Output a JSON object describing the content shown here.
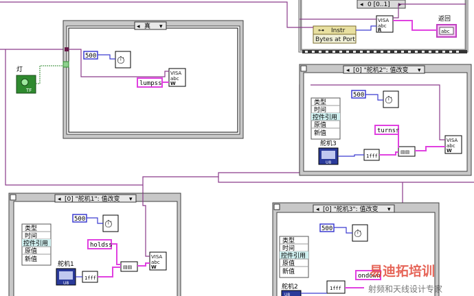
{
  "top_case": {
    "selector": "0 [0..1]",
    "property_node_label": "Instr",
    "property_item": "Bytes at Port",
    "visa_read_label": "VISA abc R",
    "indicator_label": "返回",
    "indicator_type": "abc"
  },
  "main_case": {
    "selector": "真",
    "led_label": "灯",
    "led_terminal": "TF",
    "wait_constant": "500",
    "string_constant": "lumpss",
    "visa_write_label": "VISA abc W"
  },
  "event_case_2": {
    "selector": "[0] \"舵机2\": 值改变",
    "event_fields": [
      "类型",
      "时间",
      "控件引用",
      "原值",
      "新值"
    ],
    "wait_constant": "500",
    "control_label": "舵机3",
    "control_terminal": "U8",
    "string_constant": "turnss",
    "numeric_const": "1fff",
    "visa_write_label": "VISA abc W"
  },
  "event_case_1": {
    "selector": "[0] \"舵机1\": 值改变",
    "event_fields": [
      "类型",
      "时间",
      "控件引用",
      "原值",
      "新值"
    ],
    "wait_constant": "500",
    "control_label": "舵机1",
    "control_terminal": "U8",
    "string_constant": "holdss",
    "numeric_const": "1fff",
    "visa_write_label": "VISA abc W"
  },
  "event_case_3": {
    "selector": "[0] \"舵机3\": 值改变",
    "event_fields": [
      "类型",
      "时间",
      "控件引用",
      "原值",
      "新值"
    ],
    "wait_constant": "500",
    "control_label": "舵机2",
    "control_terminal": "U8",
    "string_constant": "ondown",
    "numeric_const": "1fff",
    "visa_write_label": "VISA abc W"
  },
  "watermark": {
    "brand": "易迪拓培训",
    "tagline": "射频和天线设计专家"
  },
  "colors": {
    "visa_wire": "#8a3a8a",
    "string_wire": "#e040e0",
    "bool_wire": "#2f8a2f",
    "numeric_wire": "#3b3bd0",
    "frame_fill": "#c8c8c8",
    "frame_dark": "#606060"
  }
}
